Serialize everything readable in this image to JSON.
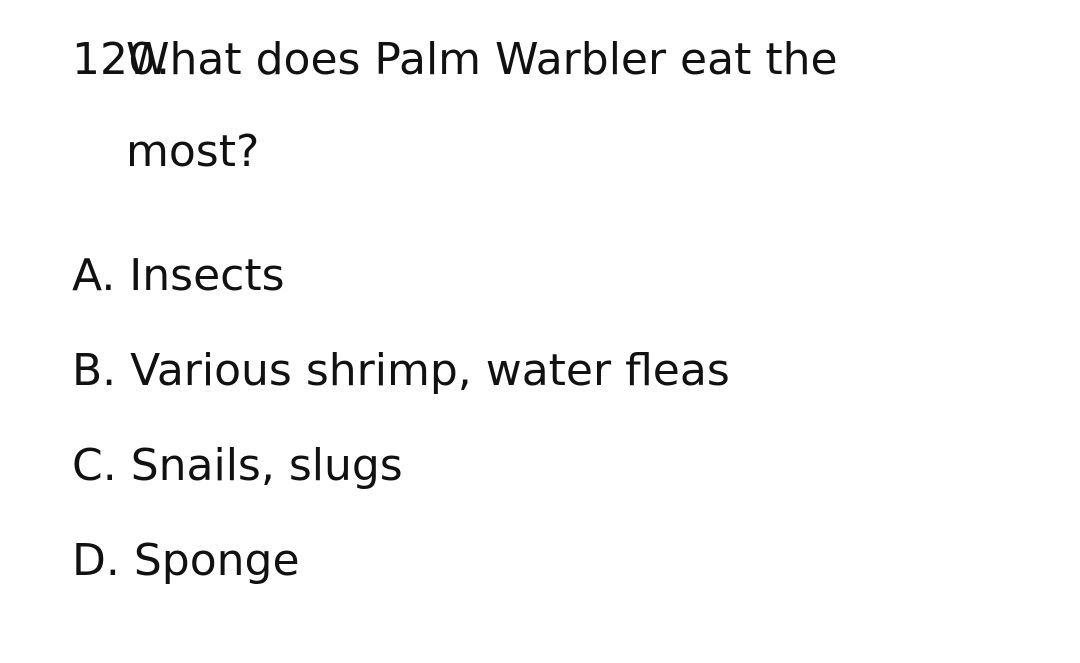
{
  "question": {
    "number": "120.",
    "text": "What does Palm Warbler eat the most?"
  },
  "options": [
    "A. Insects",
    "B. Various shrimp, water fleas",
    "C. Snails, slugs",
    "D. Sponge"
  ]
}
